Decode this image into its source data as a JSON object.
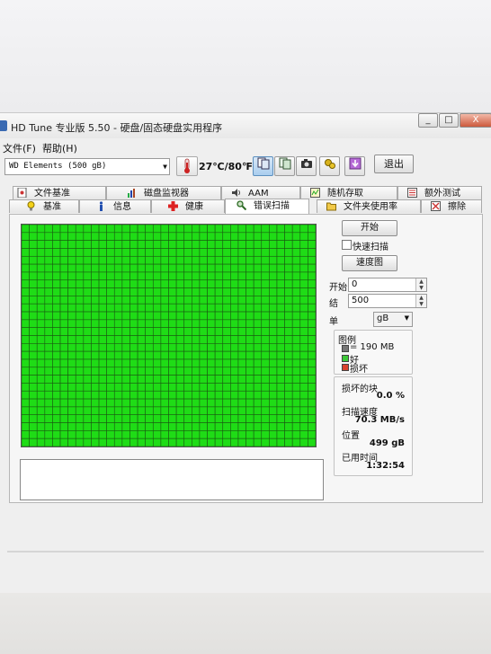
{
  "window": {
    "title": "HD Tune 专业版 5.50 - 硬盘/固态硬盘实用程序",
    "controls": [
      "_",
      "□",
      "X"
    ]
  },
  "menu": {
    "items": [
      "文件(F)",
      "帮助(H)"
    ]
  },
  "toolbar": {
    "drive": "WD     Elements (500 gB)",
    "temperature": "27℃/80℉",
    "exit_label": "退出",
    "buttons": [
      "copy-text-icon",
      "copy-screen-icon",
      "camera-icon",
      "options-icon",
      "save-down-icon"
    ]
  },
  "tabs": {
    "row1": [
      {
        "label": "文件基准",
        "icon": "file-benchmark-icon"
      },
      {
        "label": "磁盘监视器",
        "icon": "disk-monitor-icon"
      },
      {
        "label": "AAM",
        "icon": "speaker-icon"
      },
      {
        "label": "随机存取",
        "icon": "random-access-icon"
      },
      {
        "label": "额外测试",
        "icon": "extra-tests-icon"
      }
    ],
    "row2": [
      {
        "label": "基准",
        "icon": "bulb-icon"
      },
      {
        "label": "信息",
        "icon": "info-icon"
      },
      {
        "label": "健康",
        "icon": "health-cross-icon"
      },
      {
        "label": "错误扫描",
        "icon": "magnifier-icon",
        "active": true
      },
      {
        "label": "文件夹使用率",
        "icon": "folder-icon"
      },
      {
        "label": "擦除",
        "icon": "erase-icon"
      }
    ]
  },
  "scan": {
    "start_button": "开始",
    "quick_scan_label": "快速扫描",
    "quick_scan_checked": false,
    "map_button": "速度图",
    "start_label": "开始",
    "start_value": "0",
    "end_label": "结",
    "end_value": "500",
    "unit_label": "单",
    "unit_value": "gB",
    "grid": {
      "cols": 38,
      "rows": 28,
      "good_color": "#1fdc16",
      "line_color": "#1a5a12"
    }
  },
  "legend": {
    "title": "图例",
    "block_size": "= 190 MB",
    "good_label": "好",
    "bad_label": "损坏",
    "good_color": "#3ec93a",
    "bad_color": "#d9432f",
    "block_color": "#777777"
  },
  "stats": {
    "damaged_label": "损坏的块",
    "damaged_value": "0.0 %",
    "speed_label": "扫描速度",
    "speed_value": "70.3 MB/s",
    "position_label": "位置",
    "position_value": "499 gB",
    "elapsed_label": "已用时间",
    "elapsed_value": "1:32:54"
  }
}
